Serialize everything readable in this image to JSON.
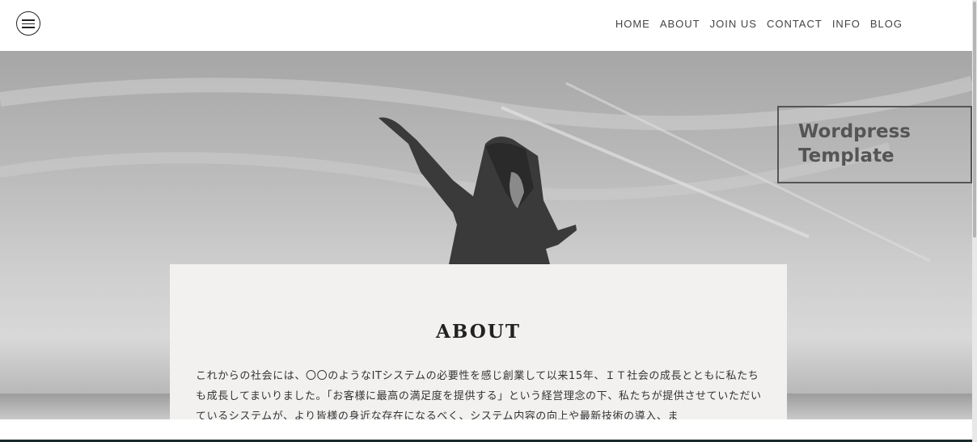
{
  "header": {
    "nav": [
      {
        "label": "HOME"
      },
      {
        "label": "ABOUT"
      },
      {
        "label": "JOIN US"
      },
      {
        "label": "CONTACT"
      },
      {
        "label": "INFO"
      },
      {
        "label": "BLOG"
      }
    ]
  },
  "hero": {
    "template_line1": "Wordpress",
    "template_line2": "Template"
  },
  "about": {
    "title": "ABOUT",
    "text": "これからの社会には、〇〇のようなITシステムの必要性を感じ創業して以来15年、ＩＴ社会の成長とともに私たちも成長してまいりました。「お客様に最高の満足度を提供する」という経営理念の下、私たちが提供させていただいているシステムが、より皆様の身近な存在になるべく、システム内容の向上や最新技術の導入、ま"
  },
  "icons": {
    "menu": "hamburger-menu-icon"
  }
}
